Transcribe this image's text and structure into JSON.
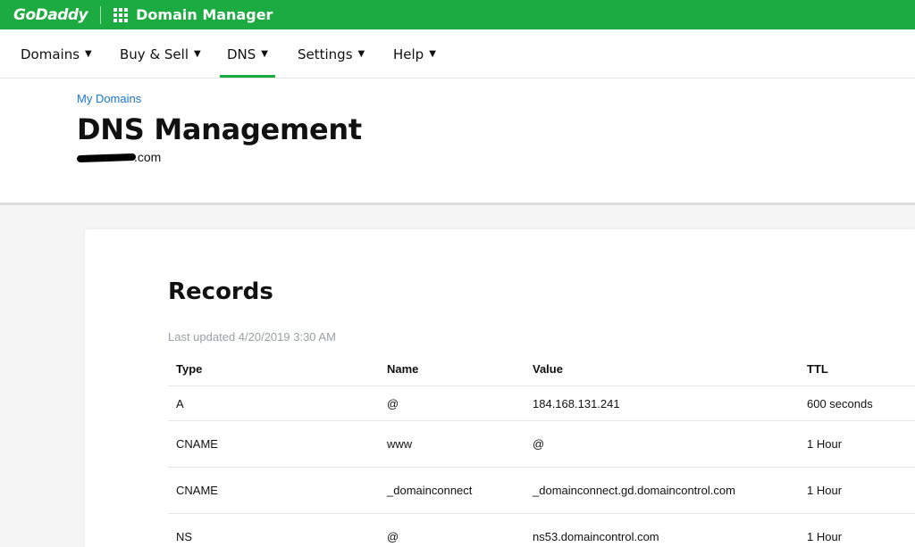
{
  "topbar": {
    "logo": "GoDaddy",
    "app_title": "Domain Manager"
  },
  "nav": {
    "items": [
      {
        "label": "Domains"
      },
      {
        "label": "Buy & Sell"
      },
      {
        "label": "DNS",
        "active": true
      },
      {
        "label": "Settings"
      },
      {
        "label": "Help"
      }
    ]
  },
  "header": {
    "breadcrumb": "My Domains",
    "title": "DNS Management",
    "domain_suffix": ".com"
  },
  "records": {
    "title": "Records",
    "last_updated": "Last updated 4/20/2019 3:30 AM",
    "columns": [
      "Type",
      "Name",
      "Value",
      "TTL"
    ],
    "rows": [
      [
        "A",
        "@",
        "184.168.131.241",
        "600 seconds"
      ],
      [
        "CNAME",
        "www",
        "@",
        "1 Hour"
      ],
      [
        "CNAME",
        "_domainconnect",
        "_domainconnect.gd.domaincontrol.com",
        "1 Hour"
      ],
      [
        "NS",
        "@",
        "ns53.domaincontrol.com",
        "1 Hour"
      ]
    ]
  },
  "colors": {
    "brand_green": "#1bab40",
    "link_blue": "#1976d2"
  }
}
